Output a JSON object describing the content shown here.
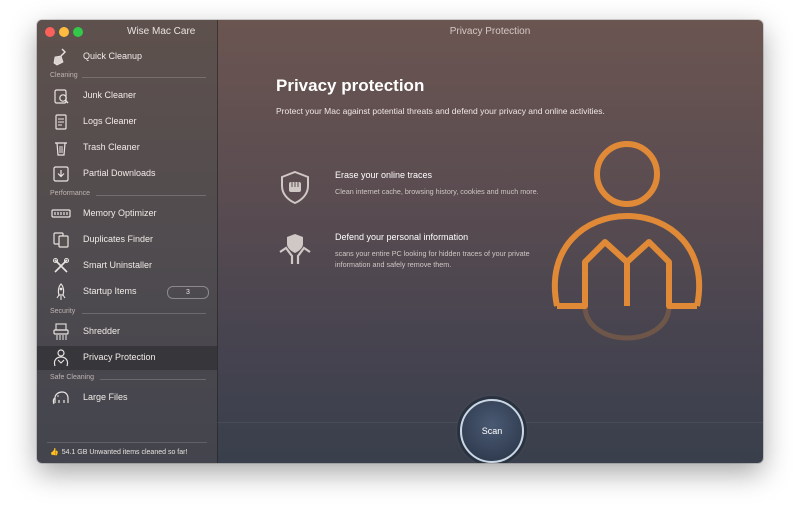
{
  "app": {
    "title": "Wise Mac Care",
    "window_title": "Privacy Protection"
  },
  "sidebar": {
    "quick_cleanup": "Quick Cleanup",
    "sections": {
      "cleaning": "Cleaning",
      "performance": "Performance",
      "security": "Security",
      "safe_cleaning": "Safe Cleaning"
    },
    "items": {
      "junk_cleaner": "Junk Cleaner",
      "logs_cleaner": "Logs Cleaner",
      "trash_cleaner": "Trash Cleaner",
      "partial_downloads": "Partial Downloads",
      "memory_optimizer": "Memory Optimizer",
      "duplicates_finder": "Duplicates Finder",
      "smart_uninstaller": "Smart Uninstaller",
      "startup_items": "Startup Items",
      "startup_count": "3",
      "shredder": "Shredder",
      "privacy_protection": "Privacy Protection",
      "large_files": "Large Files"
    },
    "footer": "54.1 GB Unwanted items cleaned so far!"
  },
  "main": {
    "heading": "Privacy protection",
    "subheading": "Protect your Mac against potential threats and defend your privacy and online activities.",
    "features": [
      {
        "title": "Erase your online traces",
        "description": "Clean internet cache, browsing history, cookies and much more.",
        "icon": "shield-fist-icon"
      },
      {
        "title": "Defend your personal information",
        "description": "scans your entire PC looking for hidden traces of your private information and safely remove them.",
        "icon": "shield-hands-icon"
      }
    ],
    "scan_label": "Scan"
  },
  "colors": {
    "accent_orange": "#e08a37",
    "active_item_bg": "#38383d"
  }
}
